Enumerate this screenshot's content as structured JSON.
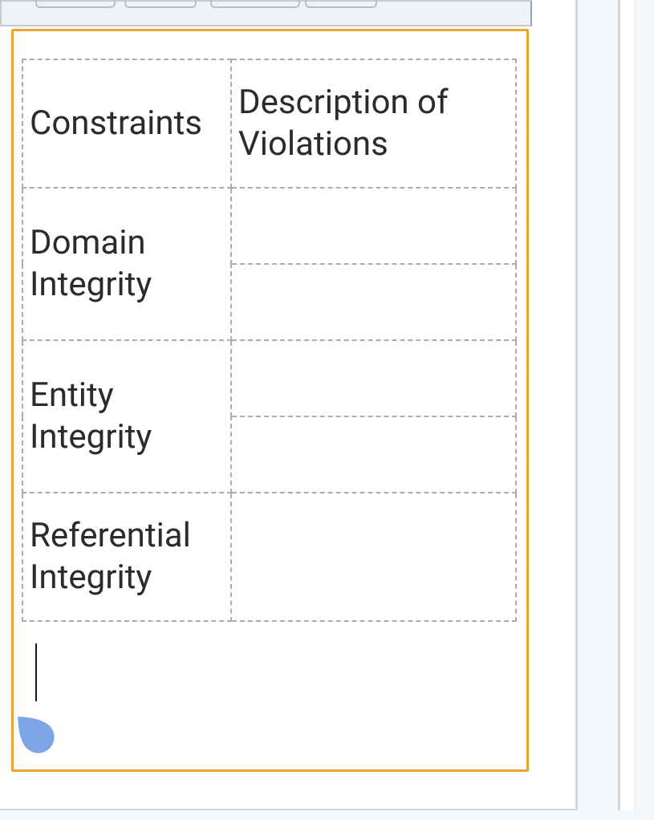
{
  "table": {
    "headers": {
      "col1": "Constraints",
      "col2": "Description of Violations"
    },
    "rows": [
      {
        "label": "Domain Integrity",
        "v1": "",
        "v2": ""
      },
      {
        "label": "Entity Integrity",
        "v1": "",
        "v2": ""
      },
      {
        "label": "Referential Integrity",
        "v1": "",
        "v2": ""
      }
    ]
  }
}
